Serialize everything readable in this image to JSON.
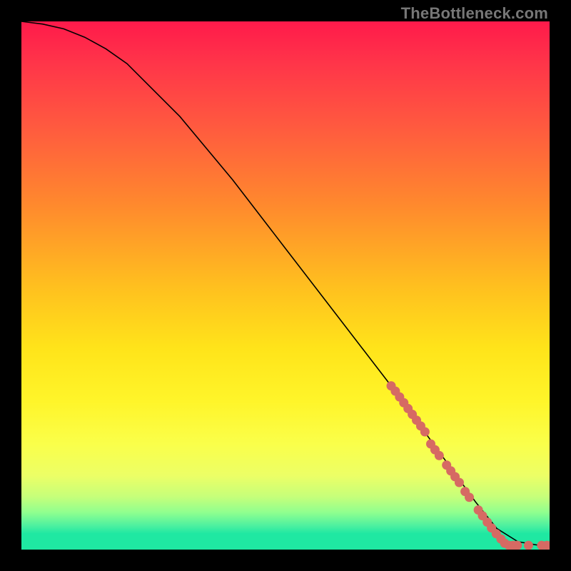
{
  "watermark": "TheBottleneck.com",
  "chart_data": {
    "type": "line",
    "title": "",
    "xlabel": "",
    "ylabel": "",
    "xlim": [
      0,
      100
    ],
    "ylim": [
      0,
      100
    ],
    "grid": false,
    "series": [
      {
        "name": "curve",
        "kind": "line",
        "color": "#000000",
        "x": [
          0,
          4,
          8,
          12,
          16,
          20,
          30,
          40,
          50,
          60,
          70,
          78,
          82,
          86,
          90,
          94,
          98,
          100
        ],
        "y": [
          100,
          99.5,
          98.6,
          97.0,
          94.8,
          92.0,
          82.0,
          70.0,
          57.0,
          44.0,
          31.0,
          20.0,
          14.5,
          9.0,
          4.0,
          1.5,
          0.8,
          0.8
        ]
      },
      {
        "name": "highlight-points",
        "kind": "scatter",
        "color": "#d66a63",
        "points": [
          {
            "x": 70.0,
            "y": 31.0
          },
          {
            "x": 70.8,
            "y": 30.0
          },
          {
            "x": 71.6,
            "y": 28.9
          },
          {
            "x": 72.4,
            "y": 27.8
          },
          {
            "x": 73.2,
            "y": 26.7
          },
          {
            "x": 74.0,
            "y": 25.6
          },
          {
            "x": 74.8,
            "y": 24.5
          },
          {
            "x": 75.6,
            "y": 23.4
          },
          {
            "x": 76.4,
            "y": 22.3
          },
          {
            "x": 77.5,
            "y": 20.0
          },
          {
            "x": 78.3,
            "y": 18.9
          },
          {
            "x": 79.1,
            "y": 17.8
          },
          {
            "x": 80.5,
            "y": 16.0
          },
          {
            "x": 81.3,
            "y": 14.9
          },
          {
            "x": 82.1,
            "y": 13.8
          },
          {
            "x": 82.9,
            "y": 12.7
          },
          {
            "x": 84.0,
            "y": 11.0
          },
          {
            "x": 84.8,
            "y": 9.9
          },
          {
            "x": 86.5,
            "y": 7.5
          },
          {
            "x": 87.3,
            "y": 6.4
          },
          {
            "x": 88.2,
            "y": 5.2
          },
          {
            "x": 89.0,
            "y": 4.1
          },
          {
            "x": 89.9,
            "y": 3.0
          },
          {
            "x": 90.8,
            "y": 2.0
          },
          {
            "x": 91.5,
            "y": 1.2
          },
          {
            "x": 92.3,
            "y": 0.8
          },
          {
            "x": 93.1,
            "y": 0.8
          },
          {
            "x": 93.9,
            "y": 0.8
          },
          {
            "x": 96.0,
            "y": 0.8
          },
          {
            "x": 98.5,
            "y": 0.8
          },
          {
            "x": 99.5,
            "y": 0.8
          }
        ]
      }
    ]
  }
}
